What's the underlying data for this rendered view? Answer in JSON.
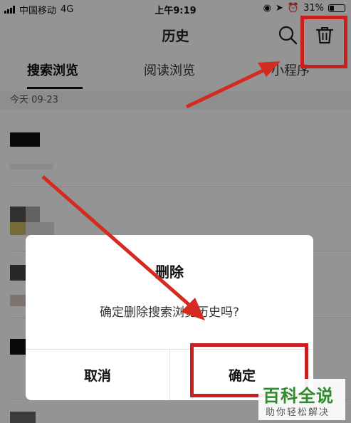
{
  "status_bar": {
    "carrier": "中国移动",
    "network": "4G",
    "time": "上午9:19",
    "battery_percent_label": "31%",
    "battery_level": 0.31
  },
  "header": {
    "title": "历史",
    "search_icon": "search-icon",
    "trash_icon": "trash-icon"
  },
  "tabs": [
    {
      "label": "搜索浏览",
      "active": true
    },
    {
      "label": "阅读浏览",
      "active": false
    },
    {
      "label": "小程序",
      "active": false
    }
  ],
  "section": {
    "date_label": "今天 09-23"
  },
  "dialog": {
    "title": "删除",
    "message": "确定删除搜索浏览历史吗?",
    "cancel_label": "取消",
    "confirm_label": "确定"
  },
  "watermark": {
    "main": "百科全说",
    "sub": "助你轻松解决"
  },
  "colors": {
    "annotation_red": "#c9201f",
    "watermark_green": "#2f8a2f"
  }
}
